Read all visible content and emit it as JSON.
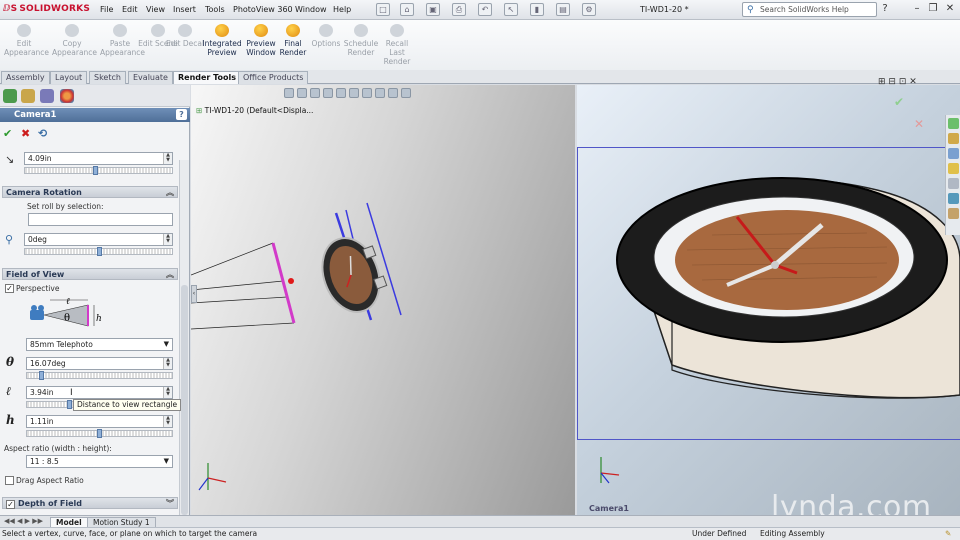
{
  "app": {
    "logo": "SOLIDWORKS",
    "doc_title": "TI-WD1-20 *"
  },
  "menu": [
    "File",
    "Edit",
    "View",
    "Insert",
    "Tools",
    "PhotoView 360",
    "Window",
    "Help"
  ],
  "search": {
    "placeholder": "Search SolidWorks Help"
  },
  "ribbon": [
    {
      "label": "Edit Appearance",
      "enabled": false
    },
    {
      "label": "Copy Appearance",
      "enabled": false
    },
    {
      "label": "Paste Appearance",
      "enabled": false
    },
    {
      "label": "Edit Scene",
      "enabled": false
    },
    {
      "label": "Edit Decal",
      "enabled": false
    },
    {
      "label": "Integrated Preview",
      "enabled": true
    },
    {
      "label": "Preview Window",
      "enabled": true
    },
    {
      "label": "Final Render",
      "enabled": true
    },
    {
      "label": "Options",
      "enabled": false
    },
    {
      "label": "Schedule Render",
      "enabled": false
    },
    {
      "label": "Recall Last Render",
      "enabled": false
    }
  ],
  "tabs": [
    "Assembly",
    "Layout",
    "Sketch",
    "Evaluate",
    "Render Tools",
    "Office Products"
  ],
  "active_tab": "Render Tools",
  "pm": {
    "title": "Camera1",
    "help": "?",
    "distance": "4.09in",
    "rotation": {
      "header": "Camera Rotation",
      "roll_label": "Set roll by selection:",
      "roll_value": "",
      "angle": "0deg"
    },
    "fov": {
      "header": "Field of View",
      "perspective_label": "Perspective",
      "perspective_checked": true,
      "lens": "85mm Telephoto",
      "theta_symbol": "θ",
      "theta": "16.07deg",
      "l_symbol": "ℓ",
      "l": "3.94in",
      "h_symbol": "h",
      "h": "1.11in",
      "aspect_label": "Aspect ratio (width : height):",
      "aspect": "11 : 8.5",
      "drag_label": "Drag Aspect Ratio",
      "drag_checked": false
    },
    "dof": {
      "header": "Depth of Field",
      "checked": true
    },
    "tooltip": "Distance to view rectangle"
  },
  "tree_item": "TI-WD1-20  (Default<Displa...",
  "viewport2_label": "Camera1",
  "watermark": "lynda.com",
  "bottom_tabs": [
    "Model",
    "Motion Study 1"
  ],
  "status": {
    "hint": "Select a vertex, curve, face, or plane on which to target the camera",
    "defined": "Under Defined",
    "mode": "Editing Assembly"
  },
  "colors": {
    "accent": "#4f6f98",
    "camera_frame": "#5056c8",
    "brand": "#c8102e"
  }
}
